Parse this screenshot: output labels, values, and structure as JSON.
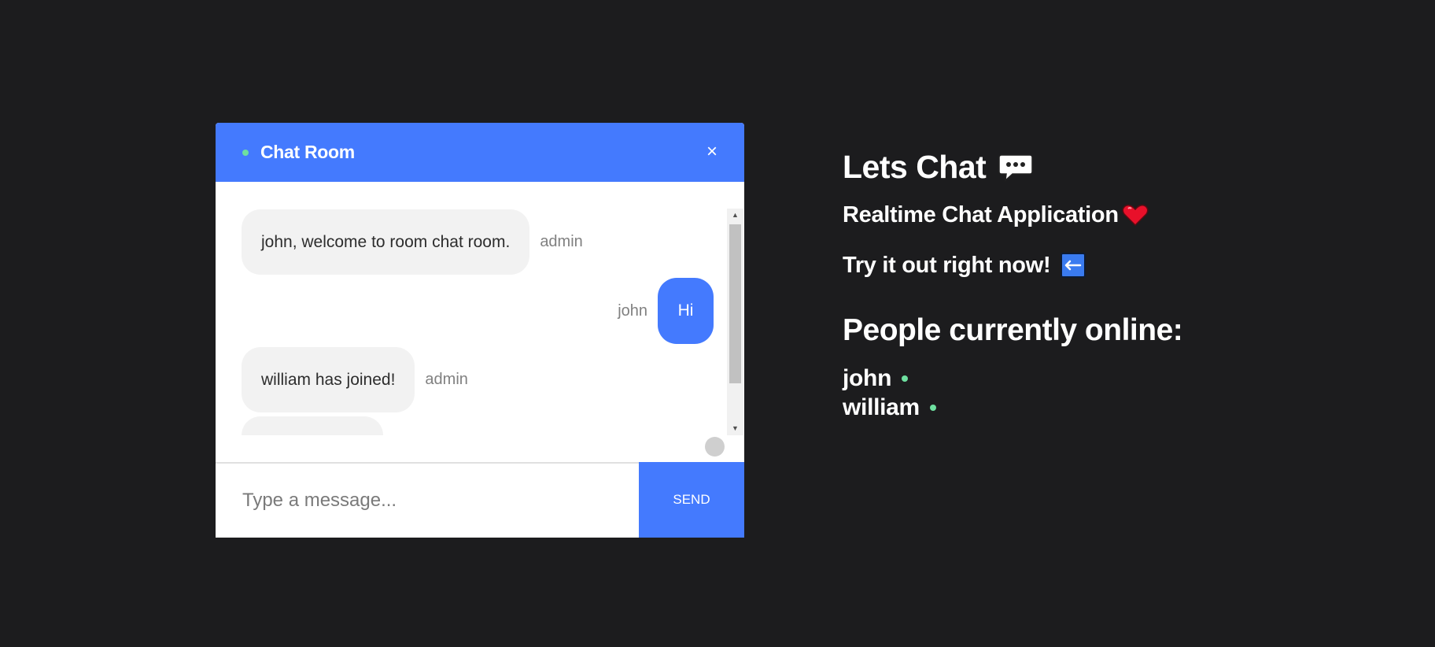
{
  "chat": {
    "title": "Chat Room",
    "close_label": "×",
    "messages": [
      {
        "text": "john, welcome to room chat room.",
        "sender": "admin",
        "direction": "incoming"
      },
      {
        "text": "Hi",
        "sender": "john",
        "direction": "outgoing"
      },
      {
        "text": "william has joined!",
        "sender": "admin",
        "direction": "incoming"
      }
    ],
    "input": {
      "placeholder": "Type a message...",
      "value": ""
    },
    "send_label": "SEND"
  },
  "side": {
    "title": "Lets Chat",
    "title_icon": "speech-balloon-icon",
    "subtitle": "Realtime Chat Application",
    "subtitle_icon": "heart-icon",
    "cta": "Try it out right now!",
    "cta_icon": "left-arrow-icon",
    "people_heading": "People currently online:",
    "online_users": [
      "john",
      "william"
    ]
  },
  "colors": {
    "accent": "#447afe",
    "online": "#6ee0a0",
    "background": "#1c1c1e",
    "heart": "#e8102a"
  }
}
